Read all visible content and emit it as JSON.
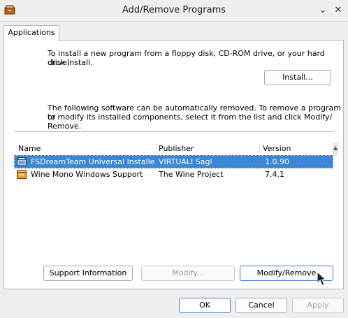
{
  "window": {
    "title": "Add/Remove Programs"
  },
  "tabs": [
    {
      "label": "Applications"
    }
  ],
  "install_section": {
    "description_line1": "To install a new program from a floppy disk, CD-ROM drive, or your hard drive,",
    "description_line2": "click Install.",
    "install_button": "Install..."
  },
  "remove_section": {
    "description_line1": "The following software can be automatically removed. To remove a program or",
    "description_line2": "to modify its installed components, select it from the list and click Modify/",
    "description_line3": "Remove."
  },
  "programs_table": {
    "columns": [
      "Name",
      "Publisher",
      "Version"
    ],
    "rows": [
      {
        "name": "FSDreamTeam Universal Installe...",
        "publisher": "VIRTUALI Sagl",
        "version": "1.0.90",
        "icon": "installer-icon",
        "selected": true
      },
      {
        "name": "Wine Mono Windows Support",
        "publisher": "The Wine Project",
        "version": "7.4.1",
        "icon": "package-icon",
        "selected": false
      }
    ]
  },
  "action_buttons": {
    "support": "Support Information",
    "modify": "Modify...",
    "modify_remove": "Modify/Remove"
  },
  "dialog_buttons": {
    "ok": "OK",
    "cancel": "Cancel",
    "apply": "Apply"
  },
  "colors": {
    "selection": "#3c86d4",
    "focus": "#3b7fd6"
  }
}
